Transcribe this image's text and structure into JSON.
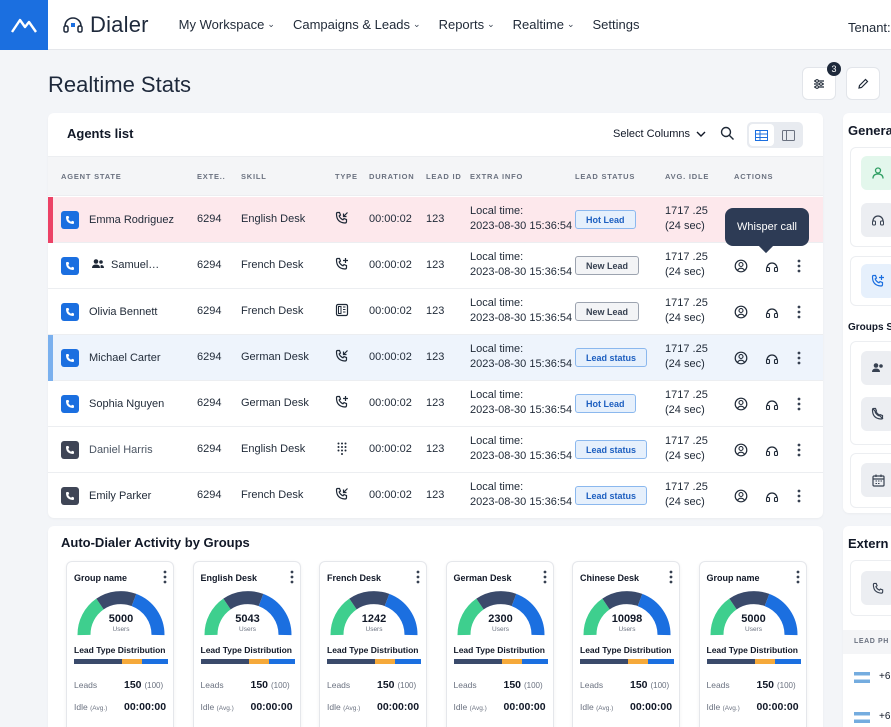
{
  "topbar": {
    "app_name": "Dialer",
    "nav": [
      "My Workspace",
      "Campaigns & Leads",
      "Reports",
      "Realtime",
      "Settings"
    ],
    "tenant_label": "Tenant:"
  },
  "page": {
    "title": "Realtime Stats",
    "filter_badge": "3"
  },
  "agents": {
    "title": "Agents list",
    "select_columns": "Select Columns",
    "columns": [
      "AGENT STATE",
      "EXTE..",
      "SKILL",
      "TYPE",
      "DURATION",
      "LEAD ID",
      "EXTRA INFO",
      "LEAD STATUS",
      "AVG. IDLE",
      "ACTIONS"
    ],
    "rows": [
      {
        "name": "Emma Rodriguez",
        "ext": "6294",
        "skill": "English Desk",
        "duration": "00:00:02",
        "lead_id": "123",
        "extra_1": "Local time:",
        "extra_2": "2023-08-30 15:36:54",
        "lead_status": "Hot Lead",
        "idle_1": "1717 .25",
        "idle_2": "(24 sec)"
      },
      {
        "name": "Samuel…",
        "ext": "6294",
        "skill": "French Desk",
        "duration": "00:00:02",
        "lead_id": "123",
        "extra_1": "Local time:",
        "extra_2": "2023-08-30 15:36:54",
        "lead_status": "New Lead",
        "idle_1": "1717 .25",
        "idle_2": "(24 sec)"
      },
      {
        "name": "Olivia Bennett",
        "ext": "6294",
        "skill": "French Desk",
        "duration": "00:00:02",
        "lead_id": "123",
        "extra_1": "Local time:",
        "extra_2": "2023-08-30 15:36:54",
        "lead_status": "New Lead",
        "idle_1": "1717 .25",
        "idle_2": "(24 sec)"
      },
      {
        "name": "Michael Carter",
        "ext": "6294",
        "skill": "German Desk",
        "duration": "00:00:02",
        "lead_id": "123",
        "extra_1": "Local time:",
        "extra_2": "2023-08-30 15:36:54",
        "lead_status": "Lead status",
        "idle_1": "1717 .25",
        "idle_2": "(24 sec)"
      },
      {
        "name": "Sophia Nguyen",
        "ext": "6294",
        "skill": "German Desk",
        "duration": "00:00:02",
        "lead_id": "123",
        "extra_1": "Local time:",
        "extra_2": "2023-08-30 15:36:54",
        "lead_status": "Hot Lead",
        "idle_1": "1717 .25",
        "idle_2": "(24 sec)"
      },
      {
        "name": "Daniel Harris",
        "ext": "6294",
        "skill": "English Desk",
        "duration": "00:00:02",
        "lead_id": "123",
        "extra_1": "Local time:",
        "extra_2": "2023-08-30 15:36:54",
        "lead_status": "Lead status",
        "idle_1": "1717 .25",
        "idle_2": "(24 sec)"
      },
      {
        "name": "Emily Parker",
        "ext": "6294",
        "skill": "French Desk",
        "duration": "00:00:02",
        "lead_id": "123",
        "extra_1": "Local time:",
        "extra_2": "2023-08-30 15:36:54",
        "lead_status": "Lead status",
        "idle_1": "1717 .25",
        "idle_2": "(24 sec)"
      }
    ],
    "tooltip": "Whisper call"
  },
  "auto_dialer": {
    "title": "Auto-Dialer Activity by Groups",
    "ltd_label": "Lead Type Distribution",
    "leads_label": "Leads",
    "idle_label": "Idle",
    "avg_label": "(Avg.)",
    "units": "Users",
    "groups": [
      {
        "name": "Group name",
        "value": "5000",
        "leads": "150",
        "leads_total": "(100)",
        "idle": "00:00:00"
      },
      {
        "name": "English Desk",
        "value": "5043",
        "leads": "150",
        "leads_total": "(100)",
        "idle": "00:00:00"
      },
      {
        "name": "French Desk",
        "value": "1242",
        "leads": "150",
        "leads_total": "(100)",
        "idle": "00:00:00"
      },
      {
        "name": "German Desk",
        "value": "2300",
        "leads": "150",
        "leads_total": "(100)",
        "idle": "00:00:00"
      },
      {
        "name": "Chinese Desk",
        "value": "10098",
        "leads": "150",
        "leads_total": "(100)",
        "idle": "00:00:00"
      },
      {
        "name": "Group name",
        "value": "5000",
        "leads": "150",
        "leads_total": "(100)",
        "idle": "00:00:00"
      }
    ]
  },
  "right": {
    "general_title": "Genera",
    "groups_title": "Groups S",
    "external_title": "Extern",
    "lead_ph": "LEAD PH",
    "phone_1": "+6",
    "phone_2": "+6"
  },
  "colors": {
    "brand": "#1b6fe0",
    "alert": "#ec4266",
    "gauge_blue": "#1b6fe0",
    "gauge_green": "#3ecf8e",
    "gauge_dark": "#3a4a6b",
    "gauge_orange": "#f5a93a"
  }
}
